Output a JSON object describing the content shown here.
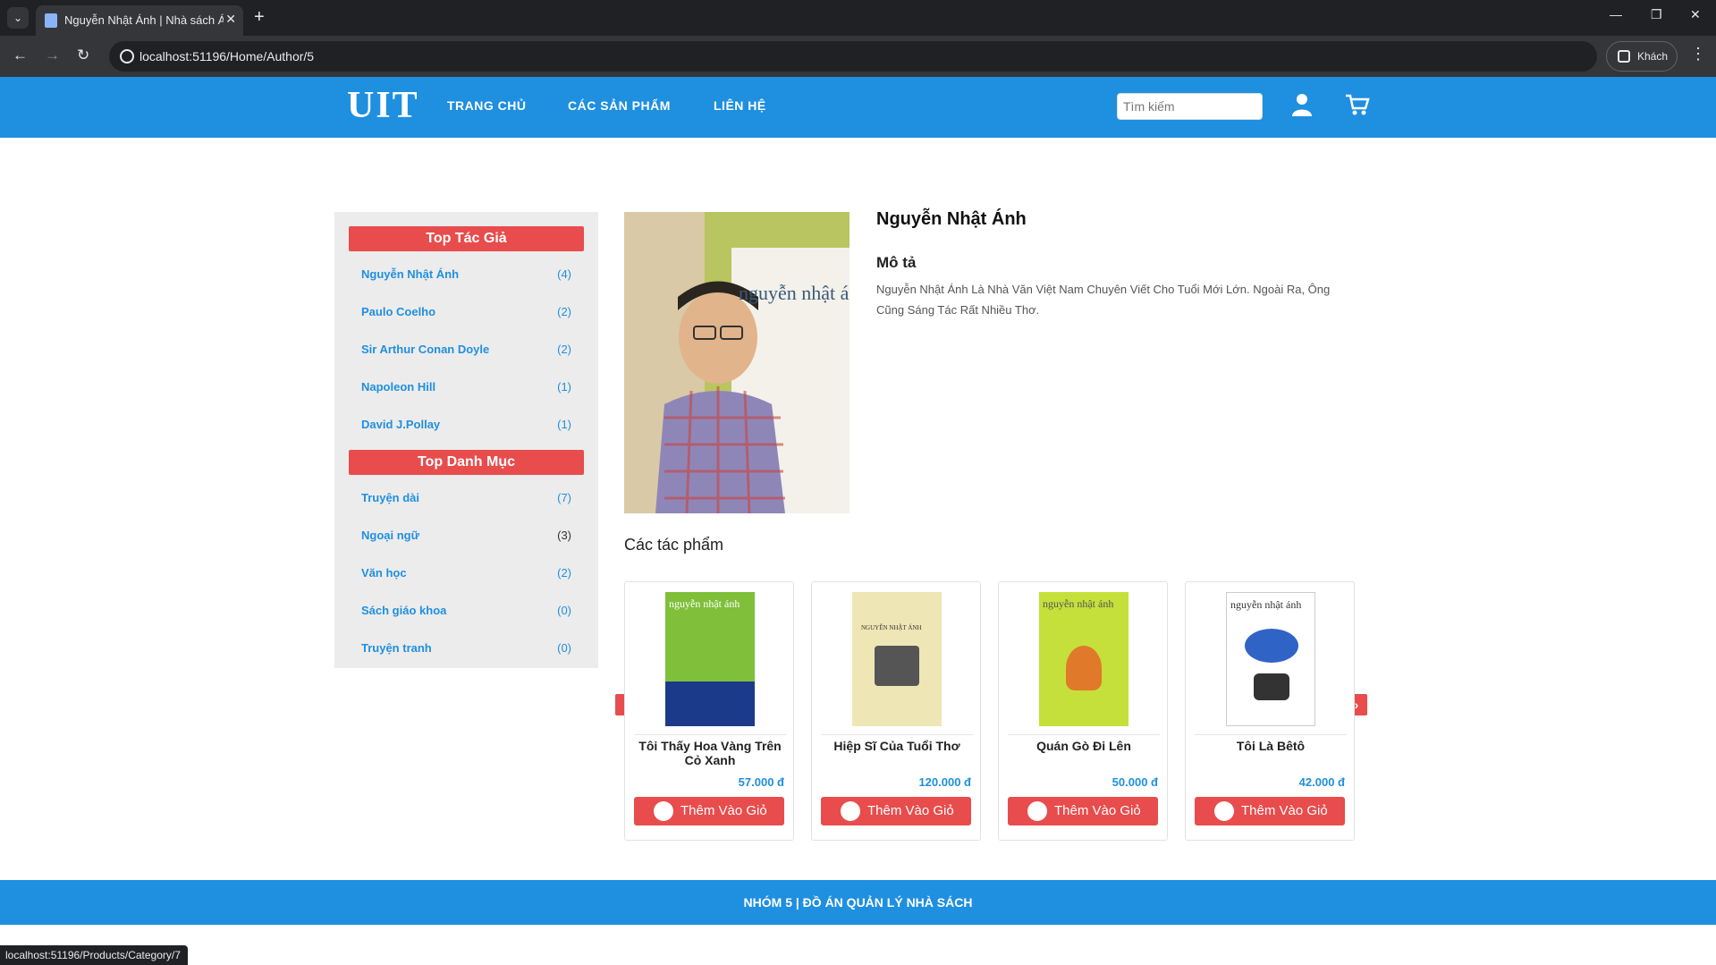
{
  "browser": {
    "tab_title": "Nguyễn Nhật Ánh | Nhà sách Á",
    "url": "localhost:51196/Home/Author/5",
    "guest_label": "Khách",
    "status_url": "localhost:51196/Products/Category/7"
  },
  "header": {
    "logo": "UIT",
    "nav": [
      "TRANG CHỦ",
      "CÁC SẢN PHẨM",
      "LIÊN HỆ"
    ],
    "search_placeholder": "Tìm kiếm"
  },
  "sidebar": {
    "authors_title": "Top Tác Giả",
    "authors": [
      {
        "name": "Nguyễn Nhật Ánh",
        "count": "(4)"
      },
      {
        "name": "Paulo Coelho",
        "count": "(2)"
      },
      {
        "name": "Sir Arthur Conan Doyle",
        "count": "(2)"
      },
      {
        "name": "Napoleon Hill",
        "count": "(1)"
      },
      {
        "name": "David J.Pollay",
        "count": "(1)"
      }
    ],
    "categories_title": "Top Danh Mục",
    "categories": [
      {
        "name": "Truyện dài",
        "count": "(7)"
      },
      {
        "name": "Ngoại ngữ",
        "count": "(3)"
      },
      {
        "name": "Văn học",
        "count": "(2)"
      },
      {
        "name": "Sách giáo khoa",
        "count": "(0)"
      },
      {
        "name": "Truyện tranh",
        "count": "(0)"
      }
    ]
  },
  "author": {
    "name": "Nguyễn Nhật Ánh",
    "desc_title": "Mô tả",
    "desc": "Nguyễn Nhật Ánh Là Nhà Văn Việt Nam Chuyên Viết Cho Tuổi Mới Lớn. Ngoài Ra, Ông Cũng Sáng Tác Rất Nhiều Thơ.",
    "photo_text": "nguyễn nhật ánh"
  },
  "works": {
    "title": "Các tác phẩm",
    "add_label": "Thêm Vào Giỏ",
    "books": [
      {
        "title": "Tôi Thấy Hoa Vàng Trên Cỏ Xanh",
        "price": "57.000 đ",
        "cover_text": "nguyễn nhật ánh",
        "cover_color": "#7fbf3a"
      },
      {
        "title": "Hiệp Sĩ Của Tuổi Thơ",
        "price": "120.000 đ",
        "cover_text": "NGUYỄN NHẬT ÁNH",
        "cover_color": "#efe6b5"
      },
      {
        "title": "Quán Gò Đi Lên",
        "price": "50.000 đ",
        "cover_text": "nguyễn nhật ánh",
        "cover_color": "#c5e03a"
      },
      {
        "title": "Tôi Là Bêtô",
        "price": "42.000 đ",
        "cover_text": "nguyễn nhật ánh",
        "cover_color": "#ffffff"
      }
    ]
  },
  "footer": {
    "text": "NHÓM 5 | ĐỒ ÁN QUẢN LÝ NHÀ SÁCH"
  },
  "colors": {
    "primary": "#1f8fe0",
    "accent": "#e84c4c"
  }
}
